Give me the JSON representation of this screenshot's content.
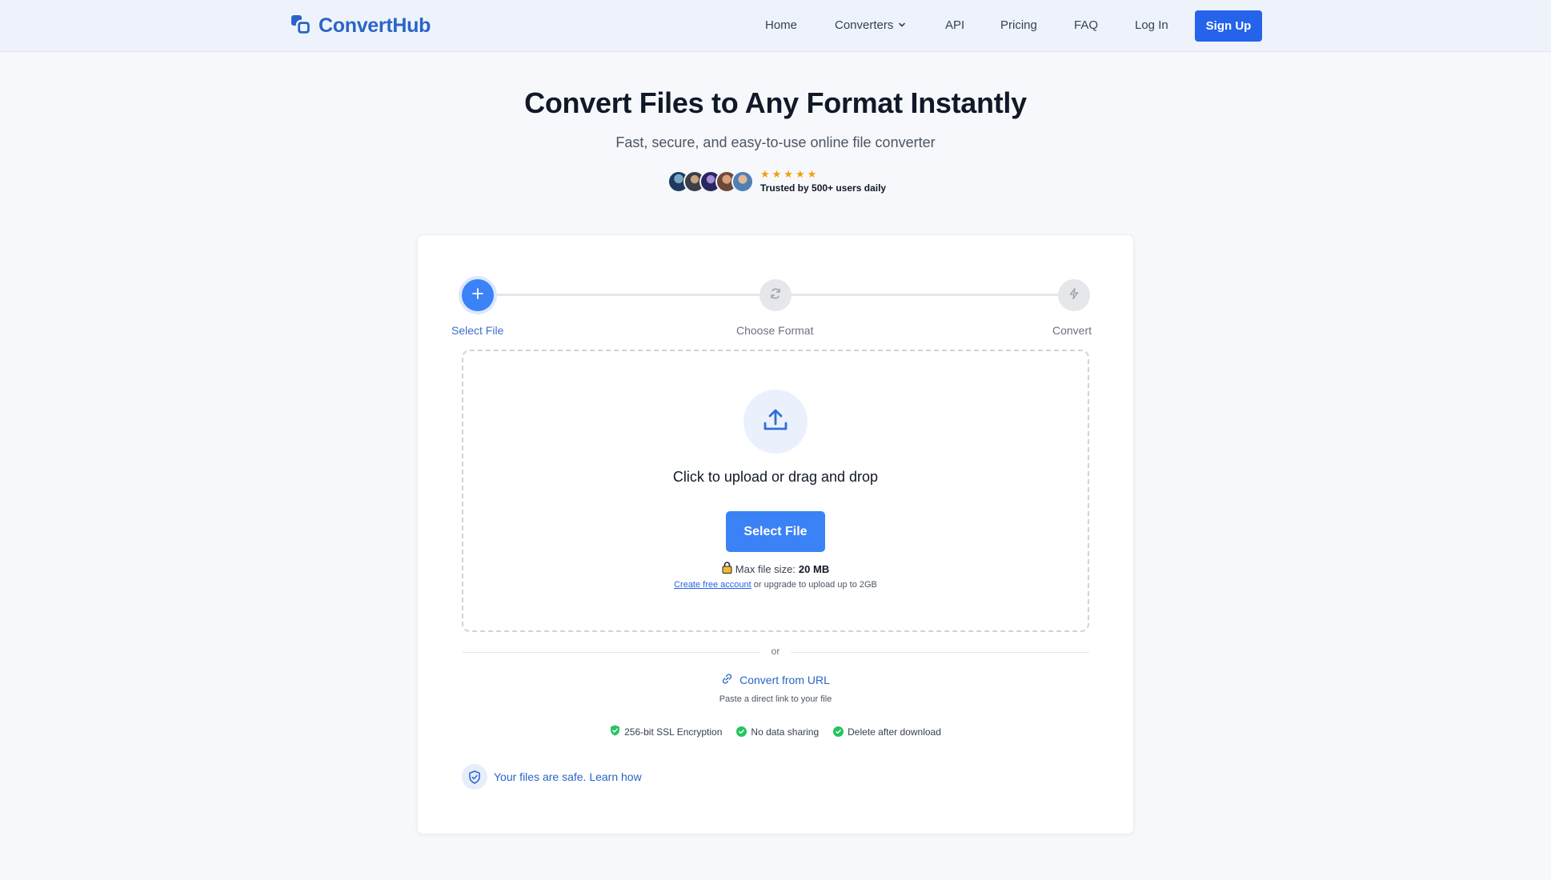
{
  "brand": {
    "name": "ConvertHub",
    "color": "#2a64c9"
  },
  "nav": {
    "home": "Home",
    "converters": "Converters",
    "api": "API",
    "pricing": "Pricing",
    "faq": "FAQ",
    "login": "Log In",
    "signup": "Sign Up"
  },
  "hero": {
    "title": "Convert Files to Any Format Instantly",
    "subtitle": "Fast, secure, and easy-to-use online file converter",
    "stars": "★★★★★",
    "trust": "Trusted by 500+ users daily"
  },
  "steps": [
    {
      "label": "Select File",
      "icon": "plus-icon",
      "state": "active"
    },
    {
      "label": "Choose Format",
      "icon": "refresh-icon",
      "state": "idle"
    },
    {
      "label": "Convert",
      "icon": "lightning-icon",
      "state": "idle"
    }
  ],
  "upload": {
    "title": "Click to upload or drag and drop",
    "button": "Select File",
    "max_label": "Max file size:",
    "max_value": "20 MB",
    "account_link": "Create free account",
    "upgrade_text": " or upgrade to upload up to 2GB"
  },
  "divider": "or",
  "url": {
    "link": "Convert from URL",
    "hint": "Paste a direct link to your file"
  },
  "security": [
    "256-bit SSL Encryption",
    "No data sharing",
    "Delete after download"
  ],
  "safe_note": "Your files are safe. Learn how",
  "colors": {
    "primary": "#3b82f6",
    "success": "#22c55e",
    "star": "#f59e0b"
  }
}
